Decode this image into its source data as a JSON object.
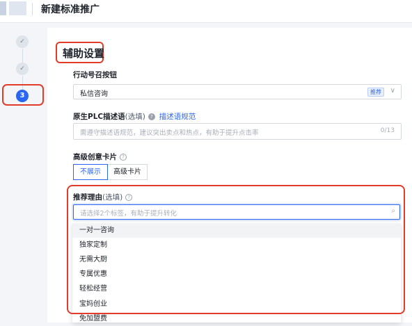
{
  "header": {
    "title": "新建标准推广"
  },
  "stepper": {
    "steps": [
      "✓",
      "✓",
      "3"
    ]
  },
  "section": {
    "title": "辅助设置"
  },
  "cta": {
    "label": "行动号召按钮",
    "value": "私信咨询",
    "tag": "推荐"
  },
  "plc": {
    "label": "原生PLC描述语",
    "optional": "(选填)",
    "link": "描述语规范",
    "placeholder": "需遵守描述语规范，建议突出卖点和热点，有助于提升点击率",
    "counter": "0/13"
  },
  "card": {
    "label": "高级创意卡片",
    "options": [
      "不展示",
      "高级卡片"
    ],
    "selected": "不展示"
  },
  "reason": {
    "label": "推荐理由",
    "optional": "(选填)",
    "placeholder": "请选择2个标签，有助于提升转化",
    "options": [
      "一对一咨询",
      "独家定制",
      "无需大厨",
      "专属优惠",
      "轻松经营",
      "宝妈创业",
      "免加盟费"
    ]
  },
  "colors": {
    "accent": "#2a66f1",
    "highlight": "#e23b2a"
  }
}
